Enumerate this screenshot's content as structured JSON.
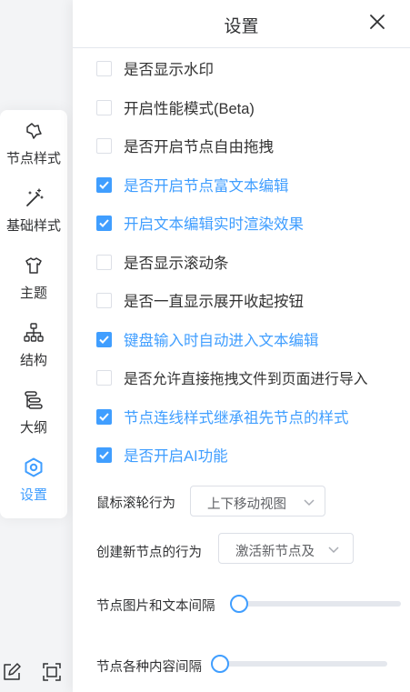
{
  "toolbar": {
    "items": [
      {
        "label": "节点样式",
        "icon": "node-style-icon",
        "active": false
      },
      {
        "label": "基础样式",
        "icon": "magic-wand-icon",
        "active": false
      },
      {
        "label": "主题",
        "icon": "shirt-icon",
        "active": false
      },
      {
        "label": "结构",
        "icon": "structure-icon",
        "active": false
      },
      {
        "label": "大纲",
        "icon": "outline-icon",
        "active": false
      },
      {
        "label": "设置",
        "icon": "settings-hexagon-icon",
        "active": true
      }
    ]
  },
  "bottom_icons": [
    "edit-icon",
    "fullscreen-icon"
  ],
  "panel": {
    "title": "设置",
    "options": [
      {
        "label": "是否显示水印",
        "checked": false
      },
      {
        "label": "开启性能模式(Beta)",
        "checked": false
      },
      {
        "label": "是否开启节点自由拖拽",
        "checked": false
      },
      {
        "label": "是否开启节点富文本编辑",
        "checked": true
      },
      {
        "label": "开启文本编辑实时渲染效果",
        "checked": true
      },
      {
        "label": "是否显示滚动条",
        "checked": false
      },
      {
        "label": "是否一直显示展开收起按钮",
        "checked": false
      },
      {
        "label": "键盘输入时自动进入文本编辑",
        "checked": true
      },
      {
        "label": "是否允许直接拖拽文件到页面进行导入",
        "checked": false
      },
      {
        "label": "节点连线样式继承祖先节点的样式",
        "checked": true
      },
      {
        "label": "是否开启AI功能",
        "checked": true
      }
    ],
    "mouse_wheel": {
      "label": "鼠标滚轮行为",
      "value": "上下移动视图"
    },
    "create_node": {
      "label": "创建新节点的行为",
      "value": "激活新节点及"
    },
    "image_text_spacing": {
      "label": "节点图片和文本间隔",
      "value": 0
    },
    "content_spacing": {
      "label": "节点各种内容间隔",
      "value": 0
    }
  },
  "colors": {
    "accent": "#409eff",
    "text": "#303133",
    "border": "#dcdfe6"
  }
}
